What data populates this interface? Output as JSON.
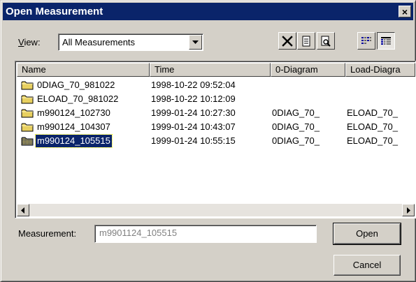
{
  "window": {
    "title": "Open Measurement",
    "close_glyph": "×"
  },
  "view": {
    "label_first": "V",
    "label_rest": "iew:",
    "selected": "All Measurements"
  },
  "toolbar": {
    "icons": [
      "delete-icon",
      "properties-icon",
      "preview-icon",
      "list-view-icon",
      "details-view-icon"
    ]
  },
  "list": {
    "columns": [
      "Name",
      "Time",
      "0-Diagram",
      "Load-Diagra"
    ],
    "rows": [
      {
        "name": "0DIAG_70_981022",
        "time": "1998-10-22 09:52:04",
        "diagram": "",
        "load": ""
      },
      {
        "name": "ELOAD_70_981022",
        "time": "1998-10-22 10:12:09",
        "diagram": "",
        "load": ""
      },
      {
        "name": "m990124_102730",
        "time": "1999-01-24 10:27:30",
        "diagram": "0DIAG_70_",
        "load": "ELOAD_70_"
      },
      {
        "name": "m990124_104307",
        "time": "1999-01-24 10:43:07",
        "diagram": "0DIAG_70_",
        "load": "ELOAD_70_"
      },
      {
        "name": "m990124_105515",
        "time": "1999-01-24 10:55:15",
        "diagram": "0DIAG_70_",
        "load": "ELOAD_70_"
      }
    ],
    "selected_index": 4
  },
  "measurement": {
    "label": "Measurement:",
    "value": "m9901124_105515"
  },
  "buttons": {
    "open": "Open",
    "cancel": "Cancel"
  },
  "colors": {
    "title_bar": "#0a246a",
    "face": "#d4d0c8",
    "selection": "#0a246a",
    "folder": "#e8d060"
  }
}
